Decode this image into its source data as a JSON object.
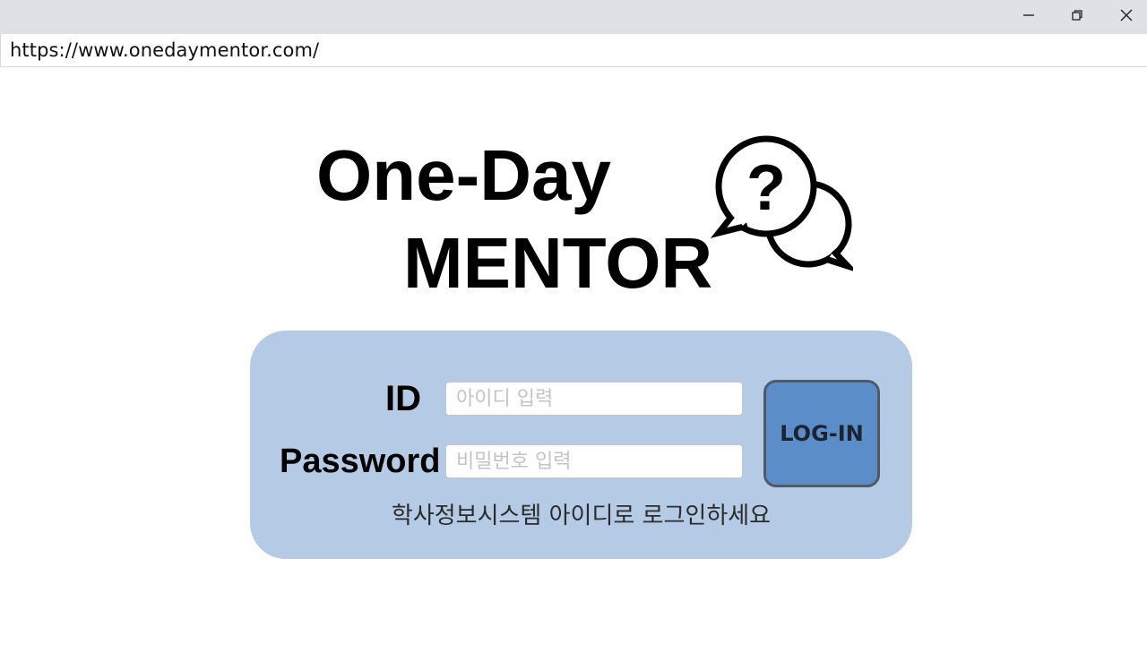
{
  "window": {
    "controls": [
      {
        "name": "minimize",
        "icon": "minimize-icon"
      },
      {
        "name": "restore",
        "icon": "restore-icon"
      },
      {
        "name": "close",
        "icon": "close-icon"
      }
    ]
  },
  "browser": {
    "url": "https://www.onedaymentor.com/"
  },
  "logo": {
    "line1": "One-Day",
    "line2": "MENTOR",
    "icon": "speech-bubbles-question-icon"
  },
  "login": {
    "id_label": "ID",
    "id_placeholder": "아이디 입력",
    "password_label": "Password",
    "password_placeholder": "비밀번호 입력",
    "button_label": "LOG-IN",
    "hint": "학사정보시스템 아이디로 로그인하세요"
  },
  "colors": {
    "card_background": "#b5cae5",
    "button_background": "#5b8dc9",
    "titlebar": "#dee1e6"
  }
}
